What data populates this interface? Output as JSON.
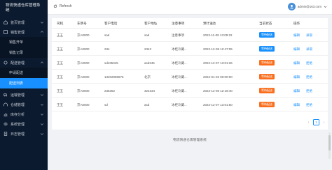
{
  "colors": {
    "sidebar_bg": "#0b1a2e",
    "accent": "#1890ff",
    "badge_blue": "#1890ff",
    "badge_orange": "#fa6e1e"
  },
  "sidebar": {
    "title_line1": "物流快递仓库管理系",
    "title_line2": "统",
    "menu": [
      {
        "label": "首页管理",
        "icon": "home-icon"
      },
      {
        "label": "销售管理",
        "icon": "sales-icon"
      },
      {
        "label": "销售开单",
        "icon": ""
      },
      {
        "label": "销售记录",
        "icon": ""
      },
      {
        "label": "配送管理",
        "icon": "delivery-icon"
      },
      {
        "label": "申请配送",
        "icon": ""
      },
      {
        "label": "配送列表",
        "icon": ""
      },
      {
        "label": "运输管理",
        "icon": "truck-icon"
      },
      {
        "label": "仓储管理",
        "icon": "warehouse-icon"
      },
      {
        "label": "库存分析",
        "icon": "chart-icon"
      },
      {
        "label": "系统管理",
        "icon": "settings-icon"
      },
      {
        "label": "日志管理",
        "icon": "log-icon"
      }
    ]
  },
  "topbar": {
    "refresh_label": "Refresh",
    "user_email": "admin@163.com"
  },
  "table": {
    "headers": [
      "司机",
      "车牌号",
      "客户电话",
      "客户地址",
      "注意事项",
      "预计送达",
      "当前状态",
      "操作"
    ],
    "rows": [
      {
        "driver": "王五",
        "plate": "京A0000",
        "phone": "sad",
        "address": "sad",
        "note": "注意事项",
        "eta": "2022-11-09 13:09:22",
        "status": "等待配送",
        "status_type": "blue",
        "edit": "编辑",
        "action2": "录取"
      },
      {
        "driver": "王五",
        "plate": "京A0000",
        "phone": "234",
        "address": "2343",
        "note": "冰柜冷藏...",
        "eta": "2022-12-08 12:47:05",
        "status": "等待配送",
        "status_type": "blue",
        "edit": "编辑",
        "action2": "录取"
      },
      {
        "driver": "王五",
        "plate": "京A0000",
        "phone": "sd435345",
        "address": "asd345",
        "note": "冰柜冷藏...",
        "eta": "2022-12-07 13:01:26",
        "status": "等待配送",
        "status_type": "orange",
        "edit": "编辑",
        "action2": "拒绝"
      },
      {
        "driver": "王五",
        "plate": "京A0000",
        "phone": "13202986876",
        "address": "北京",
        "note": "冰柜冷藏...",
        "eta": "2022-01-02 00:00:00",
        "status": "等待配送",
        "status_type": "orange",
        "edit": "编辑",
        "action2": "拒绝"
      },
      {
        "driver": "王五",
        "plate": "京A0000",
        "phone": "235352",
        "address": "324234",
        "note": "冰柜冷藏...",
        "eta": "2022-12-06 12:19:40",
        "status": "等待配送",
        "status_type": "orange",
        "edit": "编辑",
        "action2": "拒绝"
      },
      {
        "driver": "王五",
        "plate": "京A0000",
        "phone": "sd",
        "address": "asd",
        "note": "冰柜冷藏...",
        "eta": "2022-12-07 13:01:50",
        "status": "等待配送",
        "status_type": "orange",
        "edit": "编辑",
        "action2": "拒绝"
      }
    ]
  },
  "pagination": {
    "prev": "‹",
    "current": "1",
    "next": "›"
  },
  "footer": {
    "text": "物流快递仓库管理系统"
  }
}
